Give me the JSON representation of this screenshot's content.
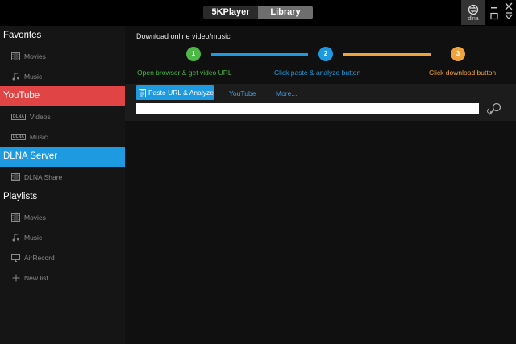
{
  "titlebar": {
    "tabs": [
      {
        "label": "5KPlayer"
      },
      {
        "label": "Library"
      }
    ],
    "dlna_label": "dlna"
  },
  "sidebar": {
    "favorites": {
      "title": "Favorites",
      "items": [
        {
          "label": "Movies"
        },
        {
          "label": "Music"
        }
      ]
    },
    "youtube": {
      "title": "YouTube",
      "items": [
        {
          "label": "Videos"
        },
        {
          "label": "Music"
        }
      ]
    },
    "dlna": {
      "title": "DLNA Server",
      "items": [
        {
          "label": "DLNA Share"
        }
      ]
    },
    "playlists": {
      "title": "Playlists",
      "items": [
        {
          "label": "Movies"
        },
        {
          "label": "Music"
        },
        {
          "label": "AirRecord"
        },
        {
          "label": "New list"
        }
      ]
    },
    "dlna_badge": "DLNA"
  },
  "main": {
    "heading": "Download online video/music",
    "steps": [
      {
        "number": "1",
        "text": "Open browser & get video URL"
      },
      {
        "number": "2",
        "text": "Click paste & analyze button"
      },
      {
        "number": "3",
        "text": "Click download button"
      }
    ],
    "paste_button": "Paste URL & Analyze",
    "links": {
      "youtube": "YouTube",
      "more": "More..."
    },
    "url_input": {
      "value": "",
      "placeholder": ""
    }
  },
  "colors": {
    "youtube": "#e04444",
    "dlna": "#1e9ae0",
    "step1": "#4cb848",
    "step2": "#1e9ae0",
    "step3": "#f0a23c"
  }
}
